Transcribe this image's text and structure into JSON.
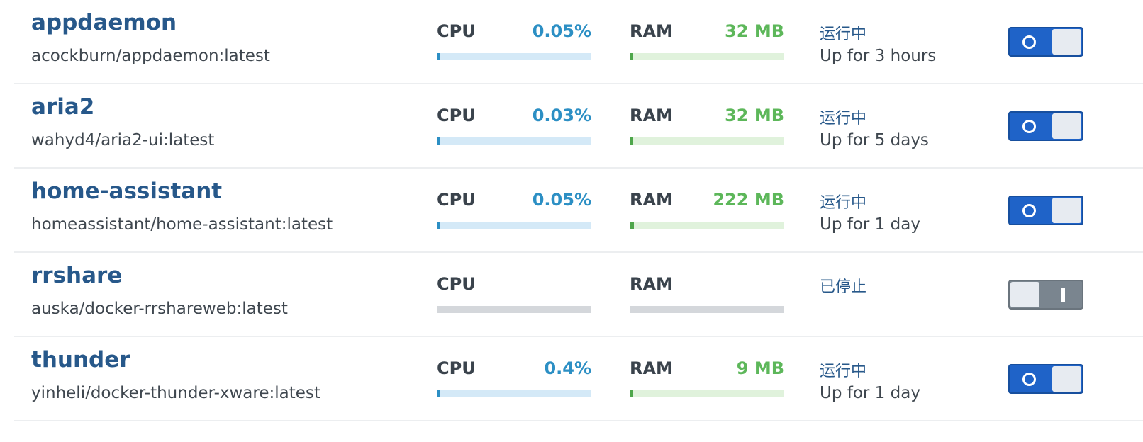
{
  "containers": [
    {
      "name": "appdaemon",
      "image": "acockburn/appdaemon:latest",
      "cpu_label": "CPU",
      "cpu": "0.05%",
      "cpu_level": 0.0005,
      "ram_label": "RAM",
      "ram": "32 MB",
      "ram_level": 0.003,
      "status": "运行中",
      "uptime": "Up for 3 hours",
      "running": true
    },
    {
      "name": "aria2",
      "image": "wahyd4/aria2-ui:latest",
      "cpu_label": "CPU",
      "cpu": "0.03%",
      "cpu_level": 0.0003,
      "ram_label": "RAM",
      "ram": "32 MB",
      "ram_level": 0.003,
      "status": "运行中",
      "uptime": "Up for 5 days",
      "running": true
    },
    {
      "name": "home-assistant",
      "image": "homeassistant/home-assistant:latest",
      "cpu_label": "CPU",
      "cpu": "0.05%",
      "cpu_level": 0.0005,
      "ram_label": "RAM",
      "ram": "222 MB",
      "ram_level": 0.027,
      "status": "运行中",
      "uptime": "Up for 1 day",
      "running": true
    },
    {
      "name": "rrshare",
      "image": "auska/docker-rrshareweb:latest",
      "cpu_label": "CPU",
      "cpu": "",
      "cpu_level": 0,
      "ram_label": "RAM",
      "ram": "",
      "ram_level": 0,
      "status": "已停止",
      "uptime": "",
      "running": false
    },
    {
      "name": "thunder",
      "image": "yinheli/docker-thunder-xware:latest",
      "cpu_label": "CPU",
      "cpu": "0.4%",
      "cpu_level": 0.004,
      "ram_label": "RAM",
      "ram": "9 MB",
      "ram_level": 0.001,
      "status": "运行中",
      "uptime": "Up for 1 day",
      "running": true
    }
  ],
  "colors": {
    "name": "#27588a",
    "cpu_value": "#2c8fc4",
    "ram_value": "#5db75a",
    "toggle_on": "#1f63c8",
    "toggle_off": "#7a858f"
  }
}
